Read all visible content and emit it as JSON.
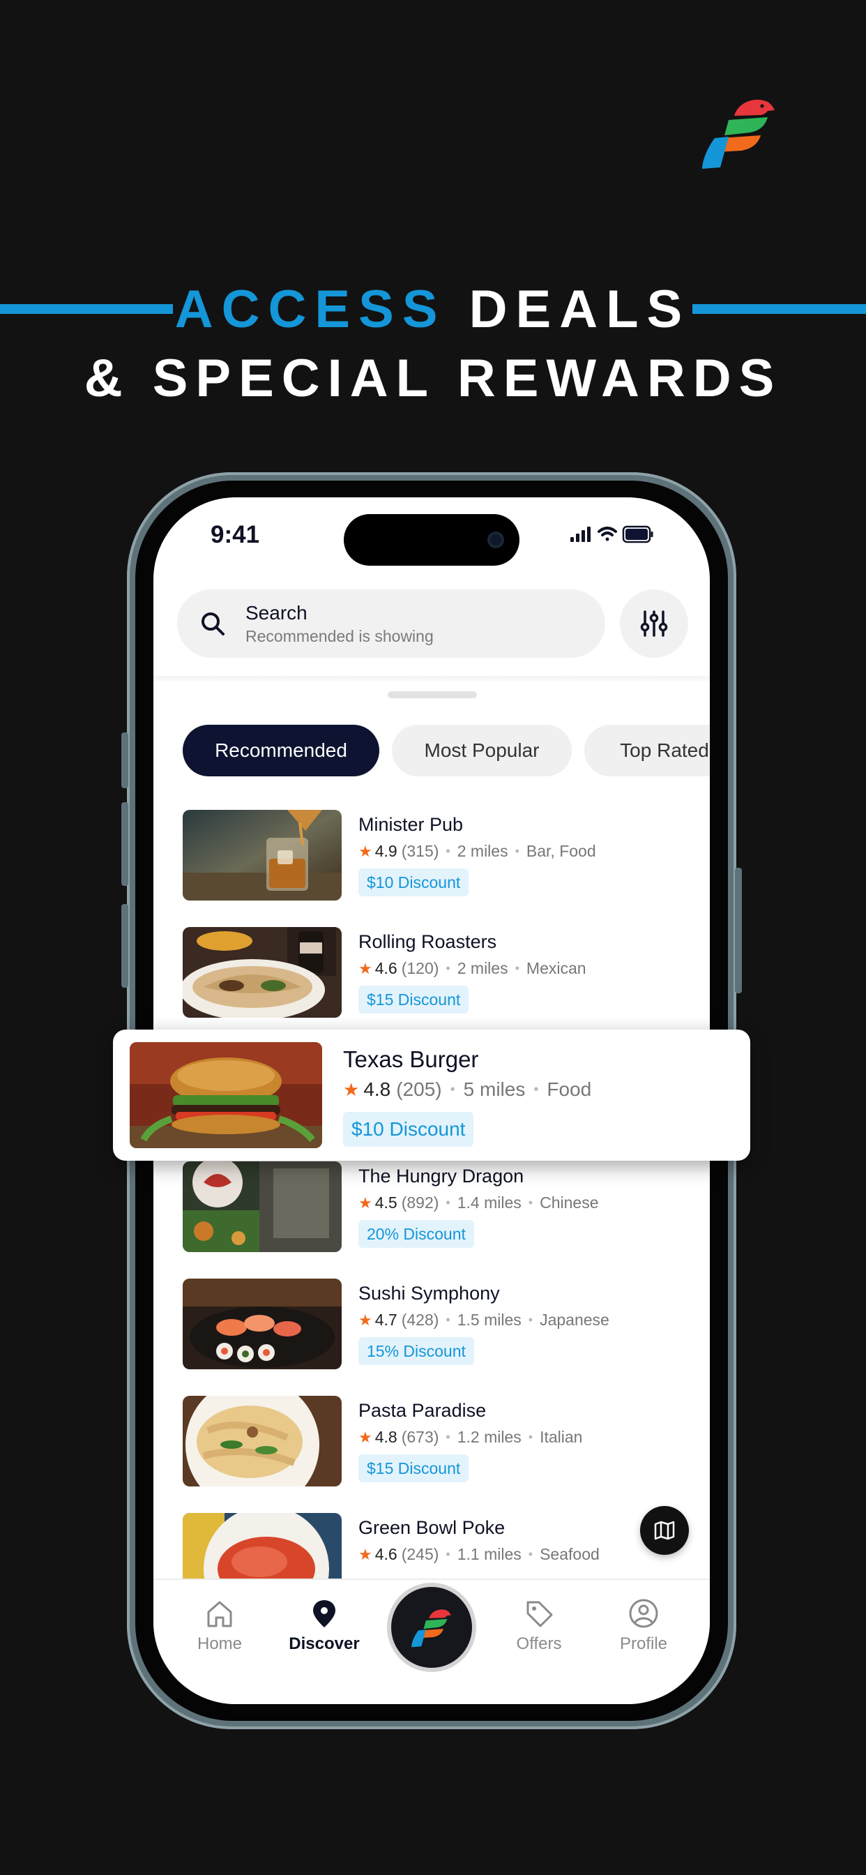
{
  "headline": {
    "accent": "ACCESS",
    "rest": "DEALS",
    "line2": "& SPECIAL REWARDS"
  },
  "colors": {
    "accent": "#1496d8",
    "background": "#121212",
    "navy": "#0d1330",
    "star": "#f26a1b"
  },
  "status_bar": {
    "time": "9:41"
  },
  "search": {
    "title": "Search",
    "subtitle": "Recommended is showing",
    "icon": "search-icon",
    "filter_icon": "sliders-icon"
  },
  "tabs": [
    {
      "label": "Recommended",
      "active": true
    },
    {
      "label": "Most Popular",
      "active": false
    },
    {
      "label": "Top Rated",
      "active": false
    }
  ],
  "restaurants": [
    {
      "name": "Minister Pub",
      "rating": "4.9",
      "reviews": "(315)",
      "distance": "2 miles",
      "category": "Bar, Food",
      "discount": "$10 Discount"
    },
    {
      "name": "Rolling Roasters",
      "rating": "4.6",
      "reviews": "(120)",
      "distance": "2 miles",
      "category": "Mexican",
      "discount": "$15 Discount"
    },
    {
      "name": "The Hungry Dragon",
      "rating": "4.5",
      "reviews": "(892)",
      "distance": "1.4 miles",
      "category": "Chinese",
      "discount": "20% Discount"
    },
    {
      "name": "Sushi Symphony",
      "rating": "4.7",
      "reviews": "(428)",
      "distance": "1.5 miles",
      "category": "Japanese",
      "discount": "15% Discount"
    },
    {
      "name": "Pasta Paradise",
      "rating": "4.8",
      "reviews": "(673)",
      "distance": "1.2 miles",
      "category": "Italian",
      "discount": "$15 Discount"
    },
    {
      "name": "Green Bowl Poke",
      "rating": "4.6",
      "reviews": "(245)",
      "distance": "1.1 miles",
      "category": "Seafood",
      "discount": ""
    }
  ],
  "featured": {
    "name": "Texas Burger",
    "rating": "4.8",
    "reviews": "(205)",
    "distance": "5 miles",
    "category": "Food",
    "discount": "$10 Discount"
  },
  "bottom_nav": {
    "home": "Home",
    "discover": "Discover",
    "offers": "Offers",
    "profile": "Profile",
    "active": "discover"
  },
  "map_button": {
    "icon": "map-icon"
  }
}
